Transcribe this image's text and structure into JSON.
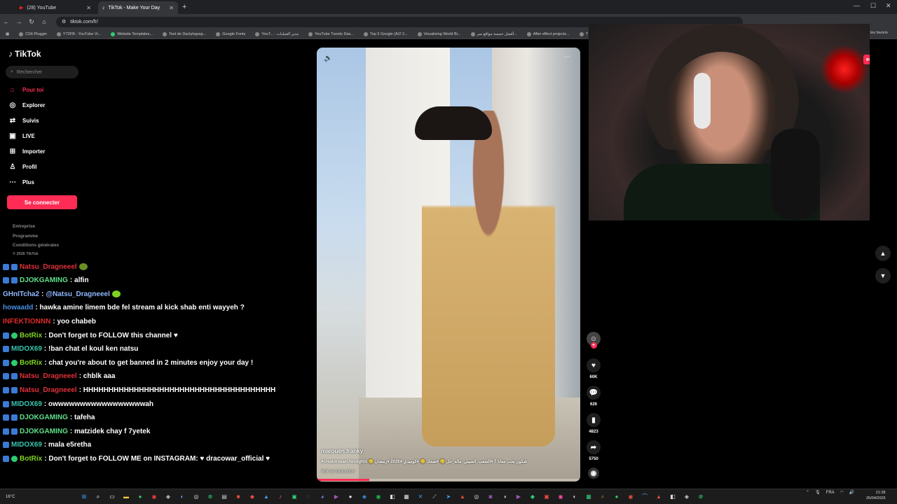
{
  "browser": {
    "tabs": [
      {
        "label": "(28) YouTube",
        "icon": "youtube-icon",
        "active": false
      },
      {
        "label": "TikTok - Make Your Day",
        "icon": "tiktok-icon",
        "active": true
      }
    ],
    "url": "tiktok.com/fr/",
    "bookmarks": [
      "CS6 Pluggin",
      "YT2FB - YouTube Vi...",
      "Website Templates...",
      "Test de Dactylograp...",
      "Google Fonts",
      "YouT... - مدير العمليات",
      "YouTube Trends Das...",
      "Top 5 Google (A/2 2...",
      "Visualizing World Bi...",
      "أفضل خمسة مواقع سر...",
      "After effect projects...",
      "T"
    ],
    "all_bookmarks": "les favoris"
  },
  "tiktok": {
    "logo": "TikTok",
    "search_placeholder": "Rechercher",
    "nav": [
      {
        "label": "Pour toi",
        "icon": "home-icon",
        "active": true
      },
      {
        "label": "Explorer",
        "icon": "compass-icon",
        "active": false
      },
      {
        "label": "Suivis",
        "icon": "following-icon",
        "active": false
      },
      {
        "label": "LIVE",
        "icon": "live-icon",
        "active": false
      },
      {
        "label": "Importer",
        "icon": "upload-icon",
        "active": false
      },
      {
        "label": "Profil",
        "icon": "profile-icon",
        "active": false
      },
      {
        "label": "Plus",
        "icon": "more-icon",
        "active": false
      }
    ],
    "login_label": "Se connecter",
    "footer": [
      "Entreprise",
      "Programme",
      "Conditions générales",
      "© 2026 TikTok"
    ],
    "video": {
      "username": "marouen.franky",
      "tags": "#creatorsearchinsights 🥲 شكون يحب معانا ؟ #الشعب_الصيني_ماله_حل 🥲 #ضحك 🥲 #كوميدي #2026 #رمضان",
      "translate": "Voir la traduction",
      "progress": 0.2,
      "likes": "60K",
      "comments": "626",
      "saves": "4823",
      "shares": "5750"
    }
  },
  "chat": [
    {
      "user": "Natsu_Dragneeel",
      "color": "#e0303a",
      "badges": [
        "sub",
        "sub"
      ],
      "text": "",
      "emote": "peepo"
    },
    {
      "user": "DJOKGAMING",
      "color": "#5fe08a",
      "badges": [
        "mod",
        "sub"
      ],
      "text": ": alfin"
    },
    {
      "user": "GHnITcha2",
      "color": "#8fb8ff",
      "badges": [],
      "text": ": ",
      "mention": "@Natsu_Dragneeel",
      "emote": "pepe"
    },
    {
      "user": "howaadd",
      "color": "#4a8fe0",
      "badges": [],
      "text": ": hawka amine limem bde fel stream al kick shab enti wayyeh ?"
    },
    {
      "user": "INFEKTIONNN",
      "color": "#e02b2b",
      "badges": [],
      "text": ": yoo chabeb"
    },
    {
      "user": "BotRix",
      "color": "#7ed321",
      "badges": [
        "sub",
        "bot"
      ],
      "text": ": Don't forget to FOLLOW this channel ♥"
    },
    {
      "user": "MIDOX69",
      "color": "#39c7b0",
      "badges": [
        "sub"
      ],
      "text": ": !ban chat el koul ken natsu"
    },
    {
      "user": "BotRix",
      "color": "#7ed321",
      "badges": [
        "sub",
        "bot"
      ],
      "text": ": chat you're about to get banned in 2 minutes enjoy your day !"
    },
    {
      "user": "Natsu_Dragneeel",
      "color": "#e0303a",
      "badges": [
        "sub",
        "sub"
      ],
      "text": ": chblk aaa"
    },
    {
      "user": "Natsu_Dragneeel",
      "color": "#e0303a",
      "badges": [
        "sub",
        "sub"
      ],
      "text": ": HHHHHHHHHHHHHHHHHHHHHHHHHHHHHHHHHHHHHH"
    },
    {
      "user": "MIDOX69",
      "color": "#39c7b0",
      "badges": [
        "sub"
      ],
      "text": ": owwwwwwwwwwwwwwwwwah"
    },
    {
      "user": "DJOKGAMING",
      "color": "#5fe08a",
      "badges": [
        "mod",
        "sub"
      ],
      "text": ": tafeha"
    },
    {
      "user": "DJOKGAMING",
      "color": "#5fe08a",
      "badges": [
        "mod",
        "sub"
      ],
      "text": ": matzidek chay f 7yetek"
    },
    {
      "user": "MIDOX69",
      "color": "#39c7b0",
      "badges": [
        "sub"
      ],
      "text": ": mala e5retha"
    },
    {
      "user": "BotRix",
      "color": "#7ed321",
      "badges": [
        "sub",
        "bot"
      ],
      "text": ": Don't forget to FOLLOW ME on INSTAGRAM: ♥ dracowar_official ♥"
    }
  ],
  "webcam": {
    "button_fragment": "ecter"
  },
  "taskbar": {
    "weather": "16°C",
    "lang": "FRA",
    "time": "21:38",
    "date": "26/04/2026"
  },
  "colors": {
    "tiktok_accent": "#fe2c55",
    "background": "#000000"
  }
}
